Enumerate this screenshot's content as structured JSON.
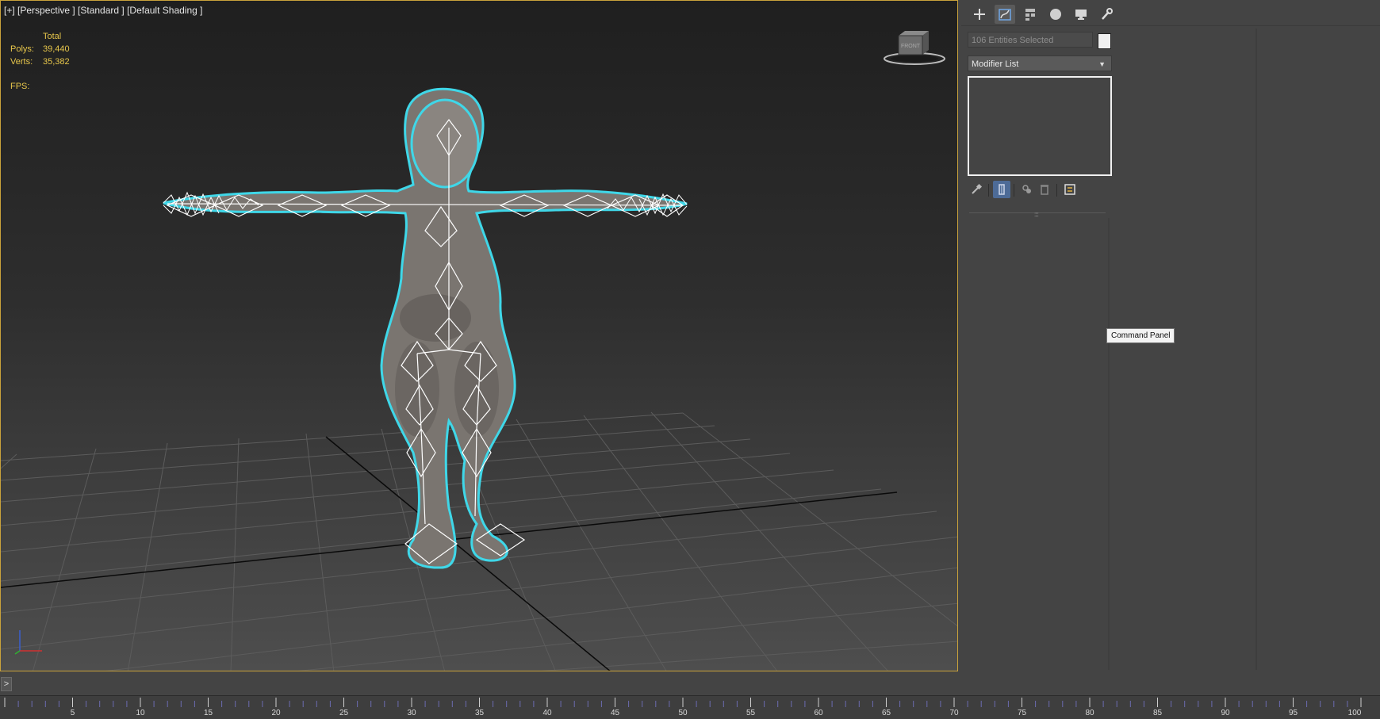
{
  "viewport": {
    "label": "[+] [Perspective ] [Standard ] [Default Shading ]",
    "stats": {
      "total_label": "Total",
      "polys_label": "Polys:",
      "polys_value": "39,440",
      "verts_label": "Verts:",
      "verts_value": "35,382",
      "fps_label": "FPS:"
    },
    "viewcube_label": "FRONT"
  },
  "command_panel": {
    "tabs": [
      {
        "icon": "create-icon"
      },
      {
        "icon": "modify-icon"
      },
      {
        "icon": "hierarchy-icon"
      },
      {
        "icon": "motion-icon"
      },
      {
        "icon": "display-icon"
      },
      {
        "icon": "utilities-icon"
      }
    ],
    "selection_text": "106 Entities Selected",
    "modifier_list": "Modifier List",
    "stack_tools": [
      "pin-stack-icon",
      "show-end-result-icon",
      "make-unique-icon",
      "remove-modifier-icon",
      "configure-modifier-sets-icon"
    ],
    "tooltip": "Command Panel"
  },
  "timeline": {
    "labels": [
      "5",
      "10",
      "15",
      "20",
      "25",
      "30",
      "35",
      "40",
      "45",
      "50",
      "55",
      "60",
      "65",
      "70",
      "75",
      "80",
      "85",
      "90",
      "95",
      "100"
    ],
    "expand_label": ">"
  },
  "colors": {
    "accent": "#c9a23b",
    "stats_text": "#e7c64b",
    "selection_outline": "#3fd7e8",
    "swatch": "#f0f0f0"
  }
}
